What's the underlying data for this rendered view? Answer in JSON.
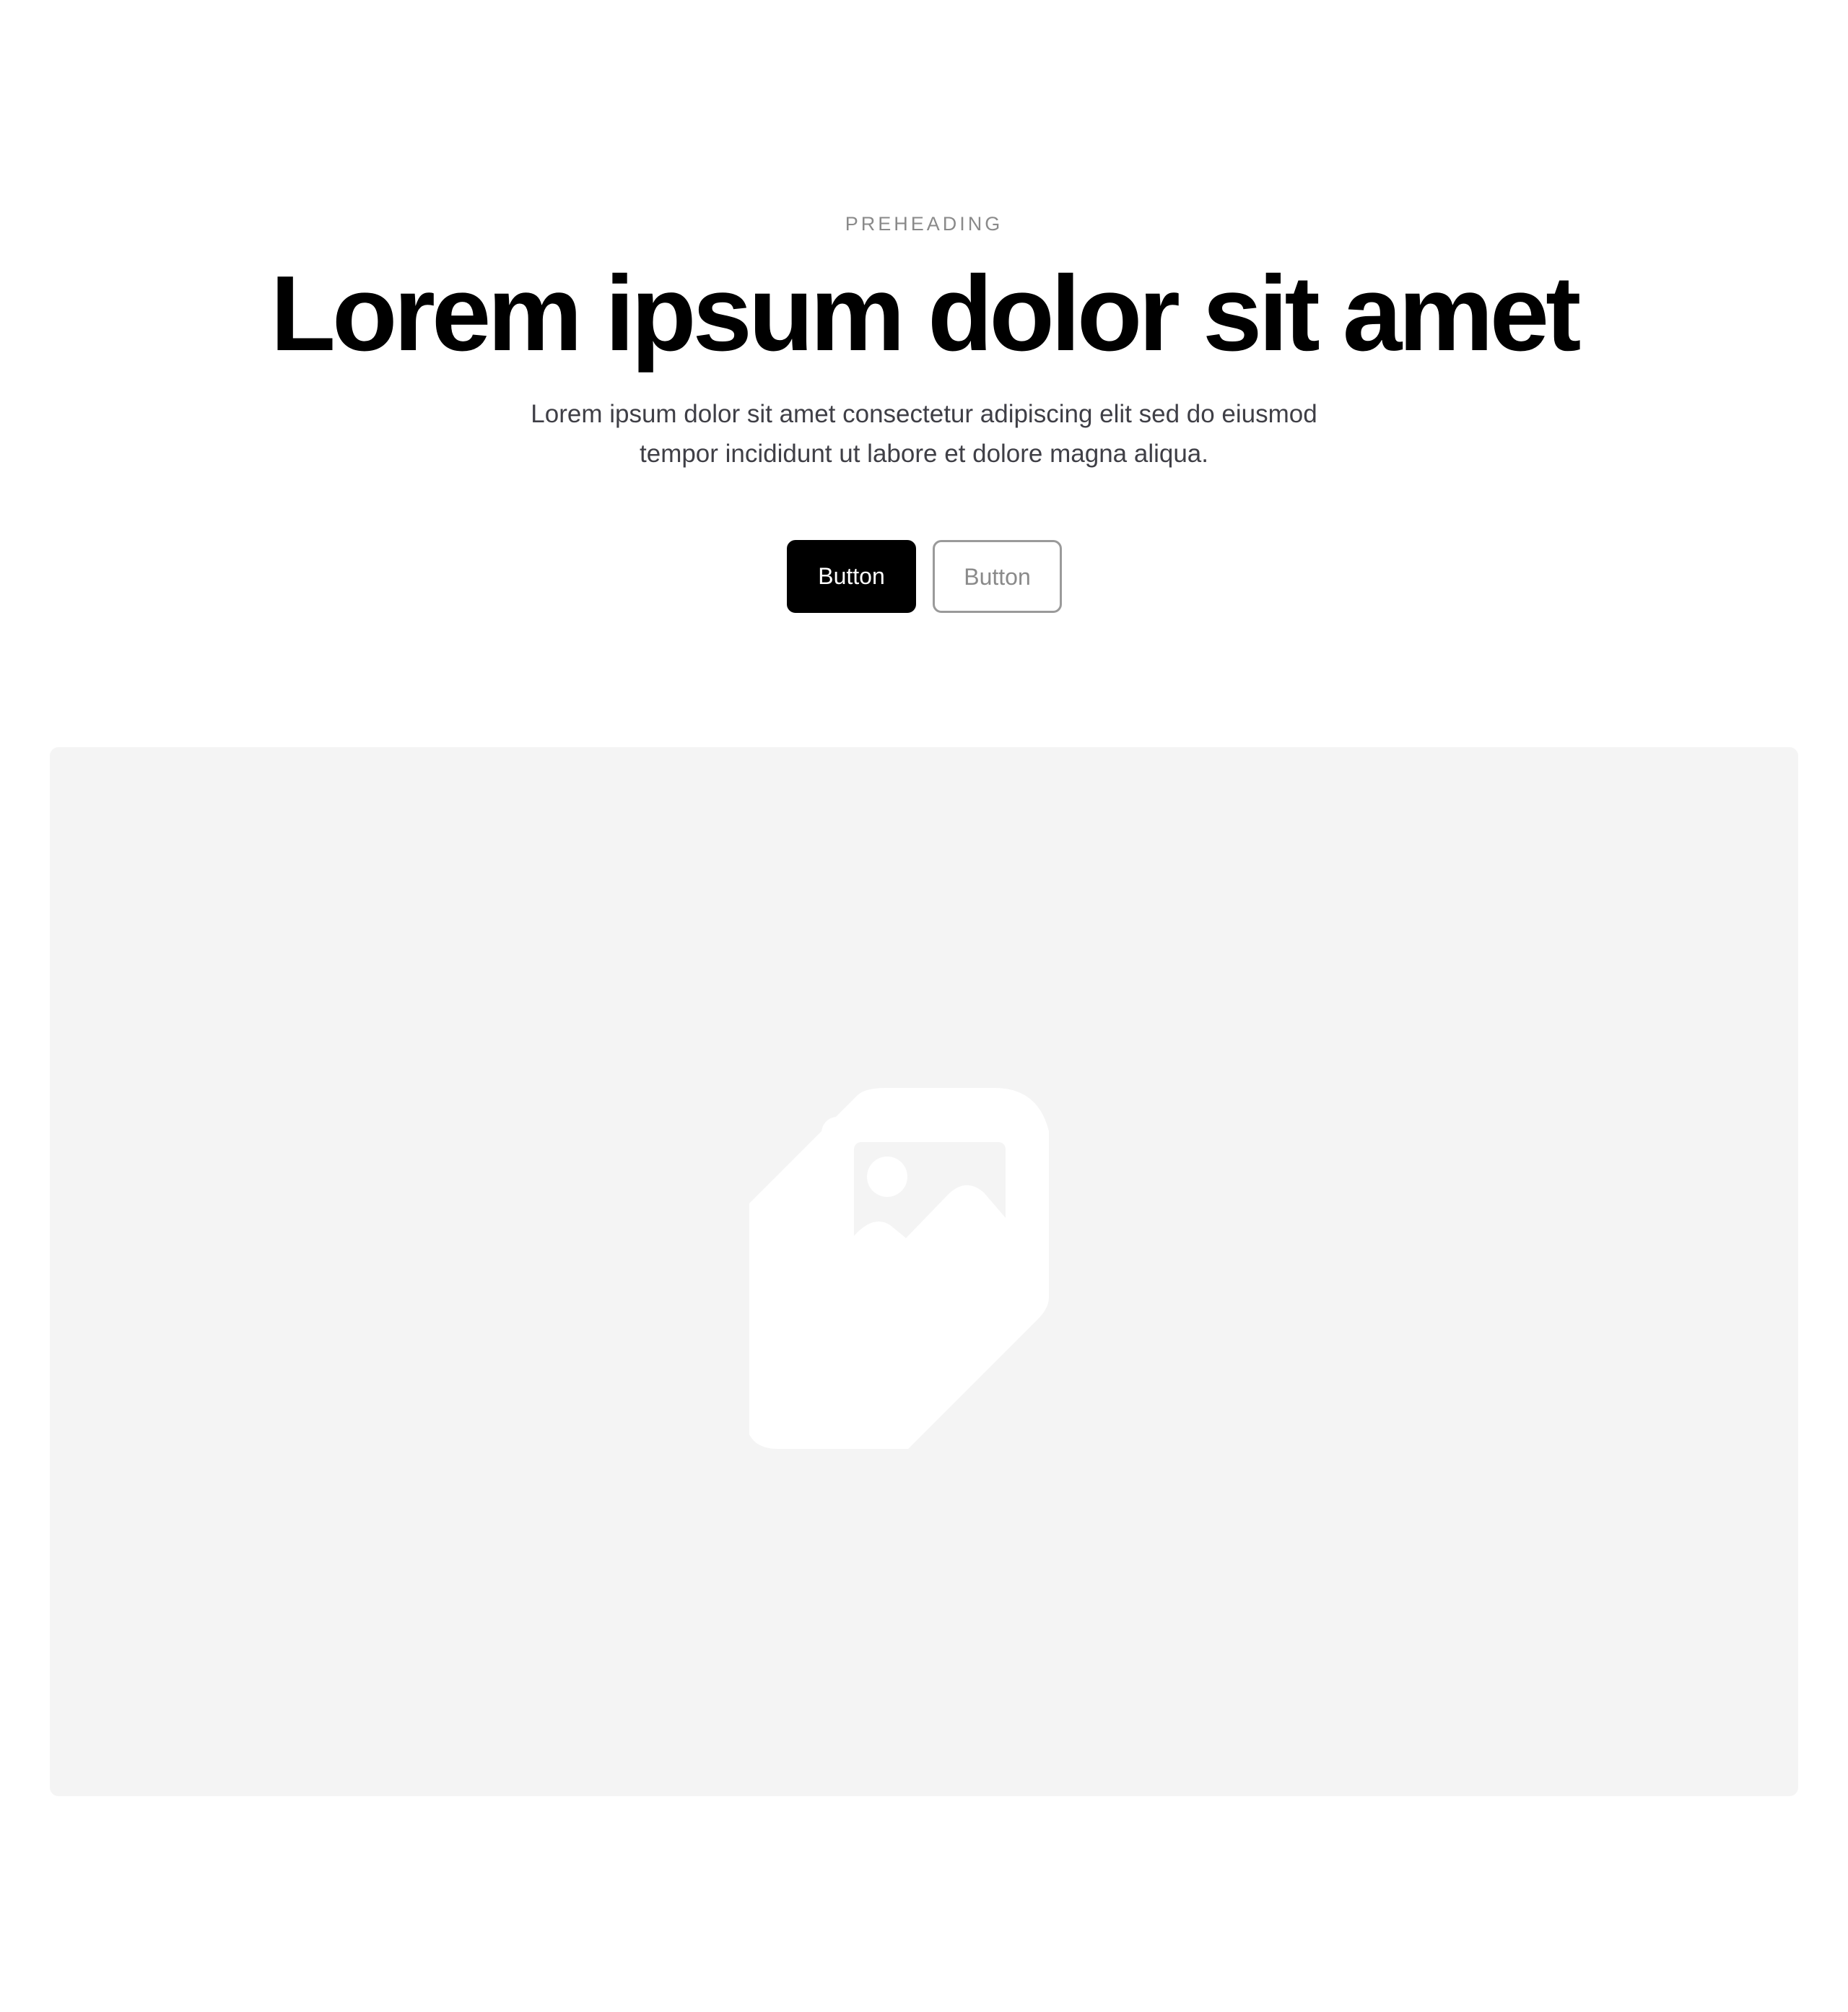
{
  "hero": {
    "preheading": "PREHEADING",
    "title": "Lorem ipsum dolor sit amet",
    "subtitle": "Lorem ipsum dolor sit amet consectetur adipiscing elit sed do eiusmod tempor incididunt ut labore et dolore magna aliqua."
  },
  "buttons": {
    "primary_label": "Button",
    "secondary_label": "Button"
  },
  "media": {
    "icon": "image-placeholder-icon",
    "background_color": "#f4f4f4"
  },
  "colors": {
    "primary_button": "#000000",
    "secondary_button_border": "#9a9a9a",
    "preheading": "#8a8a8a",
    "subtitle": "#3f3f46"
  }
}
